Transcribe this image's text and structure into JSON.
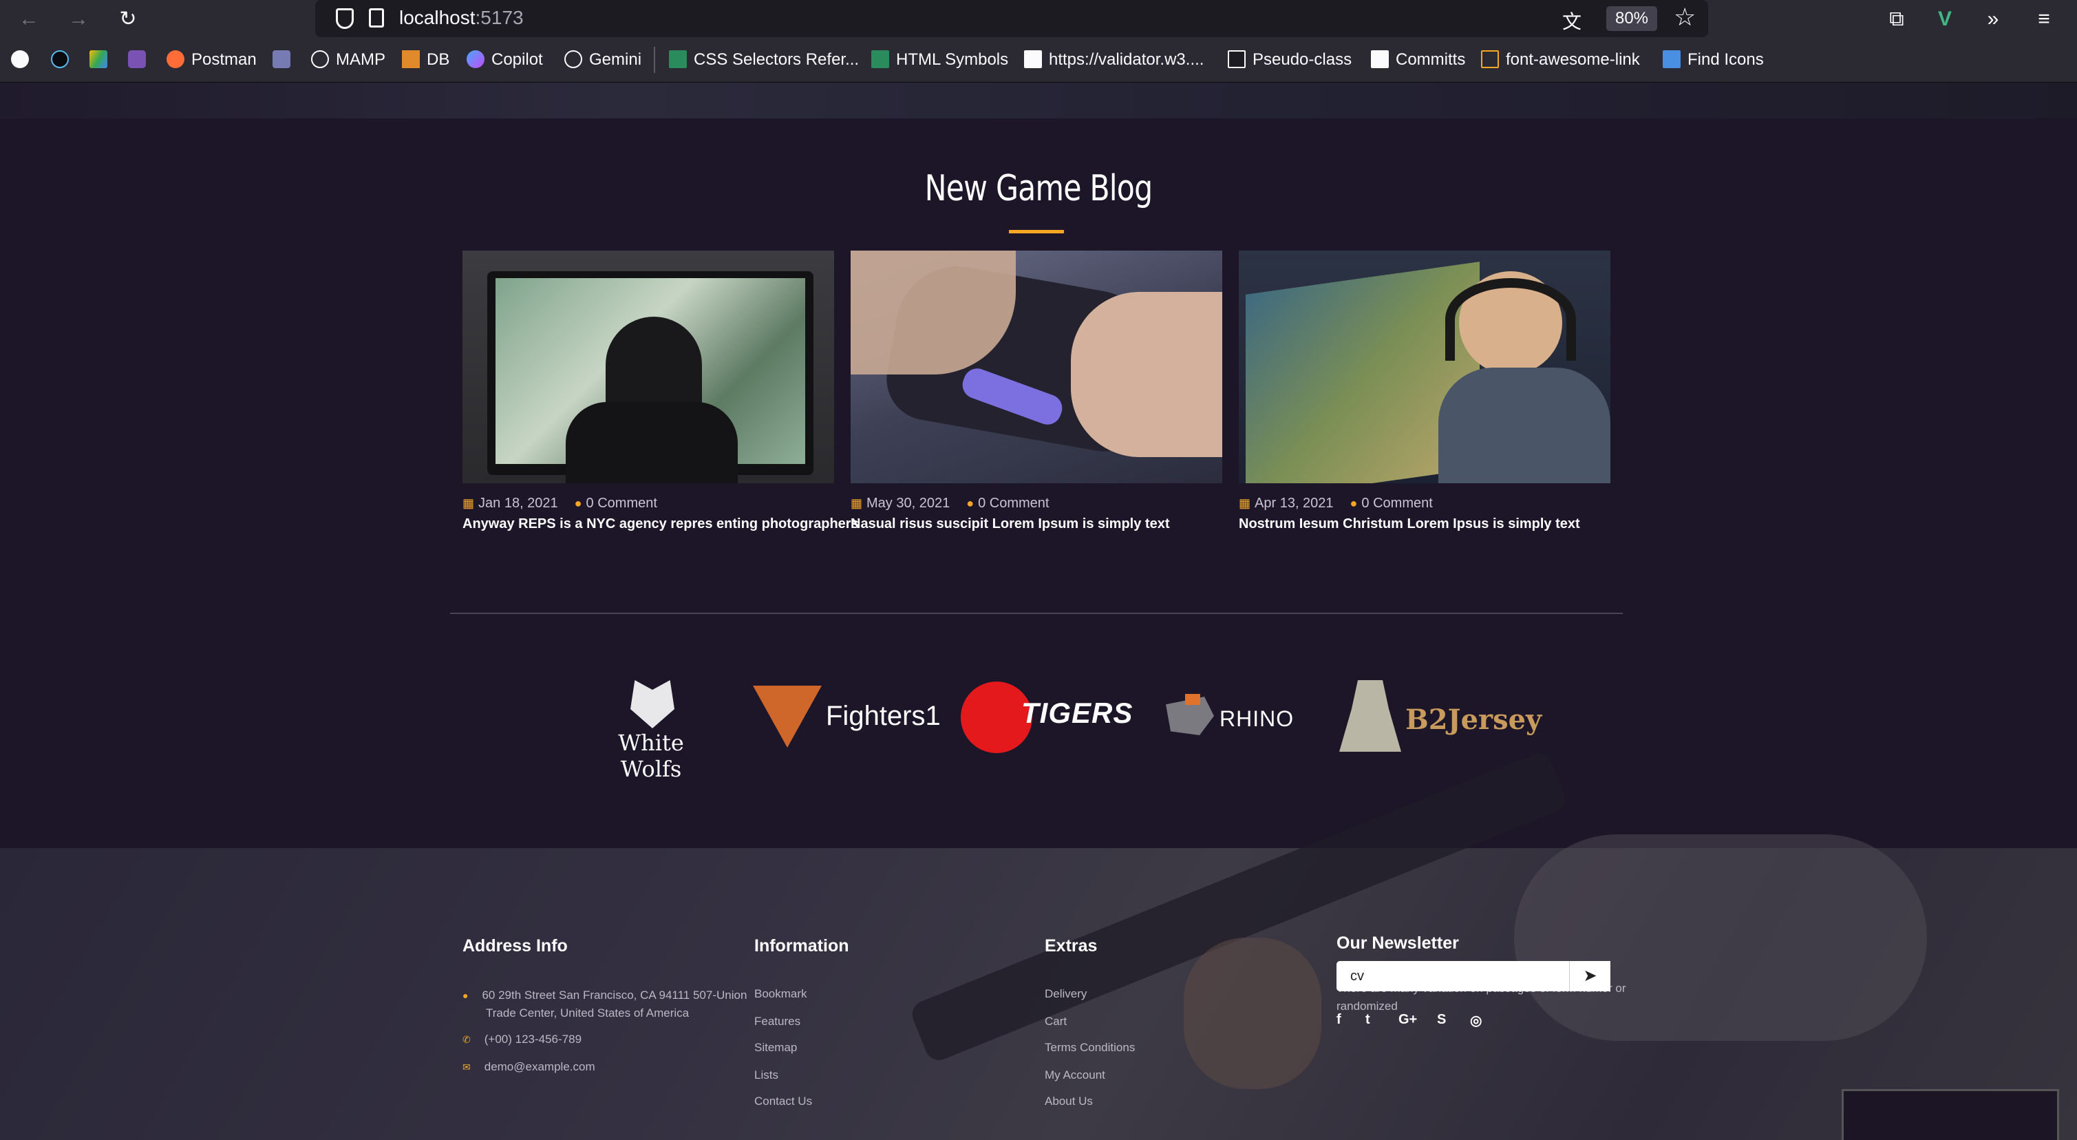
{
  "browser": {
    "url_host": "localhost",
    "url_port": ":5173",
    "zoom": "80%",
    "bookmarks": [
      "Postman",
      "MAMP",
      "DB",
      "Copilot",
      "Gemini",
      "CSS Selectors Refer...",
      "HTML Symbols",
      "https://validator.w3....",
      "Pseudo-class",
      "Committs",
      "font-awesome-link",
      "Find Icons"
    ]
  },
  "blog": {
    "title": "New Game Blog",
    "posts": [
      {
        "date": "Jan 18, 2021",
        "comments": "0 Comment",
        "title": "Anyway REPS is a NYC agency repres enting photographers"
      },
      {
        "date": "May 30, 2021",
        "comments": "0 Comment",
        "title": "Nasual risus suscipit Lorem Ipsum is simply text"
      },
      {
        "date": "Apr 13, 2021",
        "comments": "0 Comment",
        "title": "Nostrum Iesum Christum Lorem Ipsus is simply text"
      }
    ]
  },
  "brands": [
    "White Wolfs",
    "Fighters1",
    "TIGERS",
    "RHINO",
    "B2Jersey"
  ],
  "footer": {
    "address": {
      "heading": "Address Info",
      "street": "60 29th Street San Francisco, CA 94111 507-Union",
      "street2": "Trade Center, United States of America",
      "phone": "(+00) 123-456-789",
      "email": "demo@example.com"
    },
    "information": {
      "heading": "Information",
      "links": [
        "Bookmark",
        "Features",
        "Sitemap",
        "Lists",
        "Contact Us"
      ]
    },
    "extras": {
      "heading": "Extras",
      "links": [
        "Delivery",
        "Cart",
        "Terms Conditions",
        "My Account",
        "About Us"
      ]
    },
    "newsletter": {
      "heading": "Our Newsletter",
      "text1": "There are many variation on passages of form humor or",
      "text2": "randomized",
      "input_value": "cv"
    }
  },
  "colors": {
    "accent": "#f5a623",
    "background": "#1d1528"
  }
}
